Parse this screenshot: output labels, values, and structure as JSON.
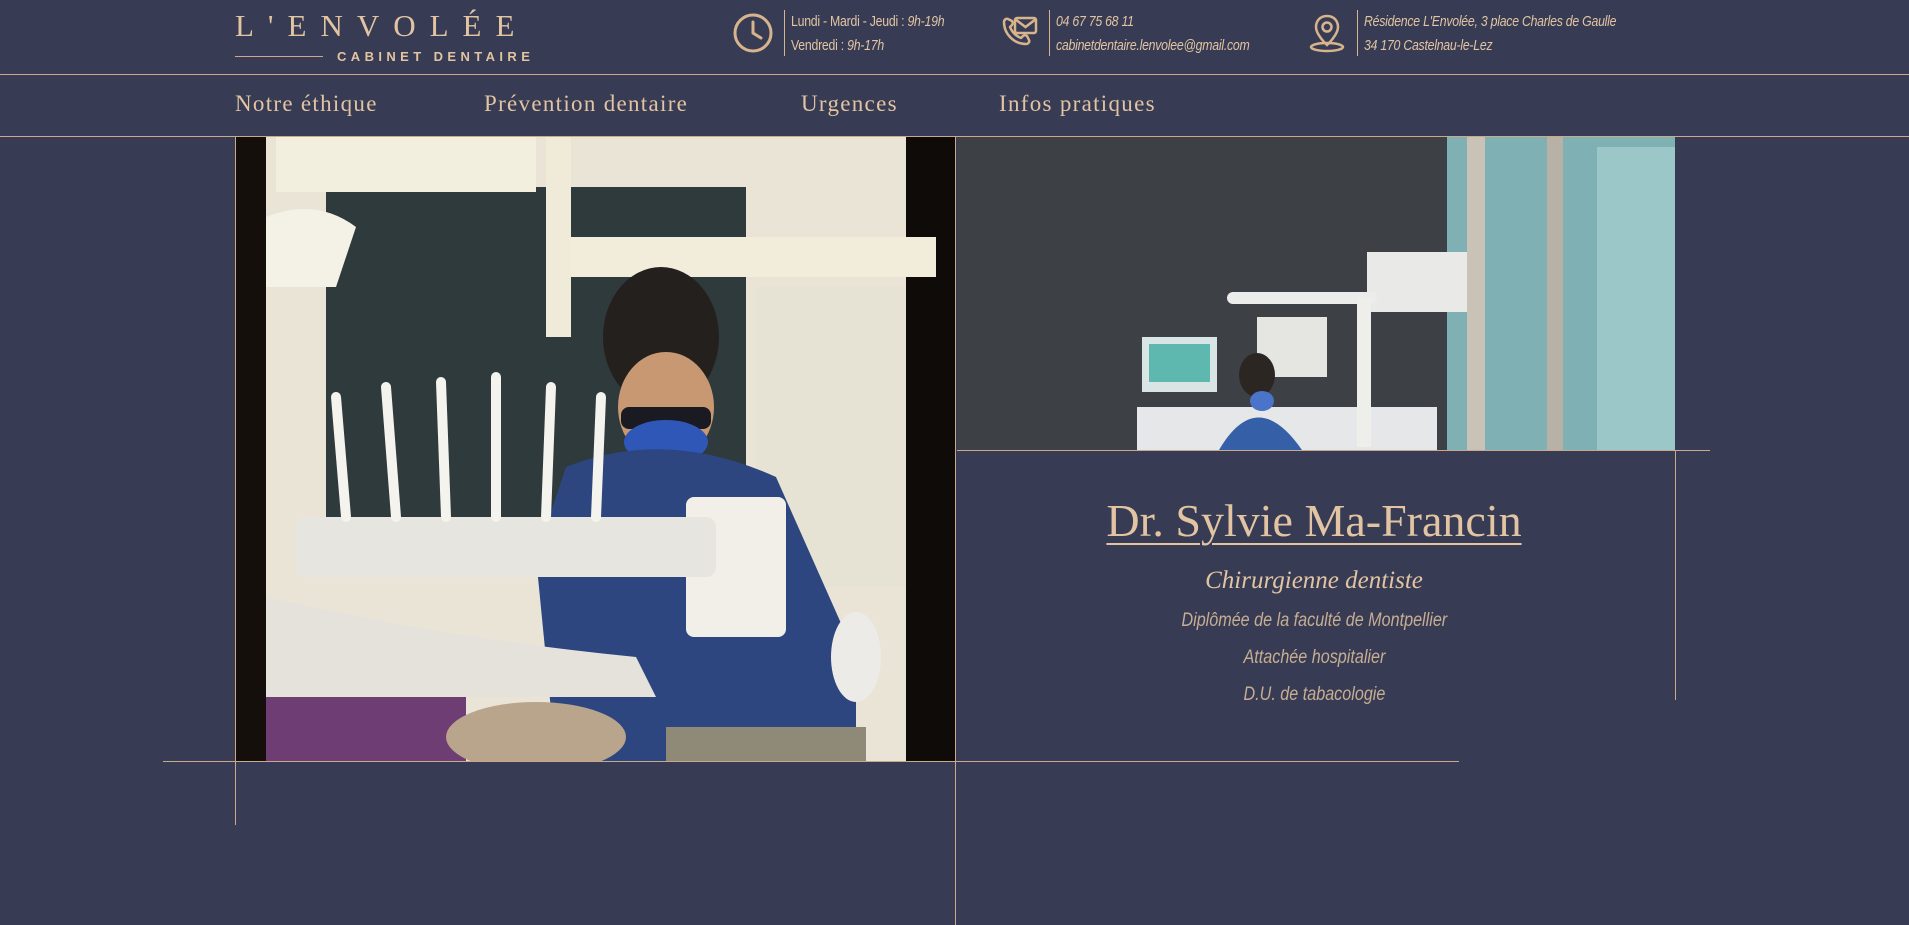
{
  "brand": {
    "name": "L'ENVOLÉE",
    "subtitle": "CABINET DENTAIRE"
  },
  "contact": {
    "hours": {
      "icon": "clock-icon",
      "line1_label": "Lundi - Mardi - Jeudi : ",
      "line1_value": "9h-19h",
      "line2_label": "Vendredi : ",
      "line2_value": "9h-17h"
    },
    "phone_email": {
      "icon": "phone-mail-icon",
      "phone": "04 67 75 68 11",
      "email": "cabinetdentaire.lenvolee@gmail.com"
    },
    "address": {
      "icon": "map-pin-icon",
      "line1": "Résidence L'Envolée, 3 place Charles de Gaulle",
      "line2": "34 170 Castelnau-le-Lez"
    }
  },
  "nav": {
    "items": [
      {
        "label": "Notre éthique"
      },
      {
        "label": "Prévention dentaire"
      },
      {
        "label": "Urgences"
      },
      {
        "label": "Infos pratiques"
      }
    ]
  },
  "doctor": {
    "name": "Dr. Sylvie Ma-Francin",
    "role": "Chirurgienne dentiste",
    "credentials": [
      "Diplômée de la faculté de Montpellier",
      "Attachée hospitalier",
      "D.U. de tabacologie"
    ]
  },
  "colors": {
    "background": "#373c54",
    "accent": "#e2c4a2",
    "line": "#c9a98a"
  }
}
